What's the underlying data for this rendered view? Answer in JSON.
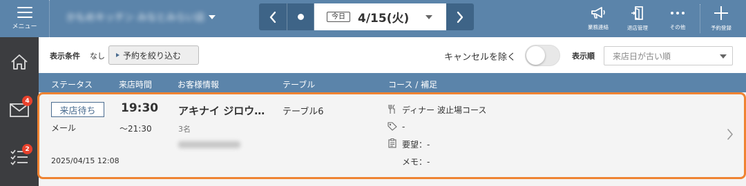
{
  "header": {
    "menu_label": "メニュー",
    "shop_name": "かもめキッチン みなとみらい店",
    "today_label": "今日",
    "date": "4/15(火)",
    "tools": [
      {
        "label": "業務連絡",
        "icon": "megaphone-icon"
      },
      {
        "label": "退店管理",
        "icon": "door-exit-icon"
      },
      {
        "label": "その他",
        "icon": "more-dots-icon"
      },
      {
        "label": "予約登録",
        "icon": "plus-icon"
      }
    ]
  },
  "sidebar": {
    "items": [
      {
        "icon": "home-icon",
        "badge": ""
      },
      {
        "icon": "mail-icon",
        "badge": "4"
      },
      {
        "icon": "checklist-icon",
        "badge": "2"
      }
    ]
  },
  "filter": {
    "condition_label": "表示条件",
    "condition_value": "なし",
    "narrow_button": "予約を絞り込む",
    "exclude_cancel_label": "キャンセルを除く",
    "exclude_cancel_on": false,
    "sort_label": "表示順",
    "sort_value": "来店日が古い順"
  },
  "table": {
    "headers": [
      "ステータス",
      "来店時間",
      "お客様情報",
      "テーブル",
      "コース / 補足"
    ],
    "rows": [
      {
        "status": "来店待ち",
        "source": "メール",
        "created": "2025/04/15 12:08",
        "time_start": "19:30",
        "time_end": "～21:30",
        "guest_name": "アキナイ ジロウ…",
        "guest_count": "3名",
        "table": "テーブル6",
        "course": "ディナー 波止場コース",
        "course_extra": "-",
        "request": "要望：-",
        "memo": "メモ：-"
      }
    ]
  }
}
